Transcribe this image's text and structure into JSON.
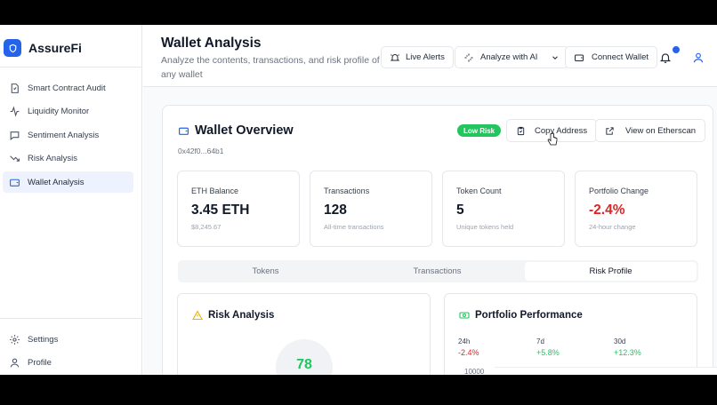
{
  "brand": {
    "name": "AssureFi"
  },
  "sidebar": {
    "items": [
      {
        "label": "Smart Contract Audit",
        "icon": "audit-icon"
      },
      {
        "label": "Liquidity Monitor",
        "icon": "activity-icon"
      },
      {
        "label": "Sentiment Analysis",
        "icon": "message-icon"
      },
      {
        "label": "Risk Analysis",
        "icon": "trending-down-icon"
      },
      {
        "label": "Wallet Analysis",
        "icon": "wallet-icon",
        "active": true
      }
    ],
    "bottom": [
      {
        "label": "Settings",
        "icon": "gear-icon"
      },
      {
        "label": "Profile",
        "icon": "user-icon"
      }
    ]
  },
  "header": {
    "title": "Wallet Analysis",
    "subtitle": "Analyze the contents, transactions, and risk profile of any wallet",
    "live_alerts": "Live Alerts",
    "analyze_ai": "Analyze with AI",
    "connect_wallet": "Connect Wallet"
  },
  "overview": {
    "title": "Wallet Overview",
    "address": "0x42f0...64b1",
    "risk_badge": "Low Risk",
    "copy_address": "Copy Address",
    "view_etherscan": "View on Etherscan",
    "stats": [
      {
        "label": "ETH Balance",
        "value": "3.45 ETH",
        "sub": "$8,245.67"
      },
      {
        "label": "Transactions",
        "value": "128",
        "sub": "All-time transactions"
      },
      {
        "label": "Token Count",
        "value": "5",
        "sub": "Unique tokens held"
      },
      {
        "label": "Portfolio Change",
        "value": "-2.4%",
        "sub": "24-hour change"
      }
    ],
    "tabs": [
      "Tokens",
      "Transactions",
      "Risk Profile"
    ],
    "active_tab": "Risk Profile"
  },
  "risk_panel": {
    "title": "Risk Analysis",
    "score": "78"
  },
  "performance": {
    "title": "Portfolio Performance",
    "periods": [
      {
        "label": "24h",
        "value": "-2.4%",
        "trend": "negative"
      },
      {
        "label": "7d",
        "value": "+5.8%",
        "trend": "positive"
      },
      {
        "label": "30d",
        "value": "+12.3%",
        "trend": "positive"
      }
    ],
    "axis_tick": "10000"
  },
  "colors": {
    "accent": "#2563eb",
    "positive": "#22c55e",
    "negative": "#dc2626",
    "active_nav": "#eef2ff"
  }
}
